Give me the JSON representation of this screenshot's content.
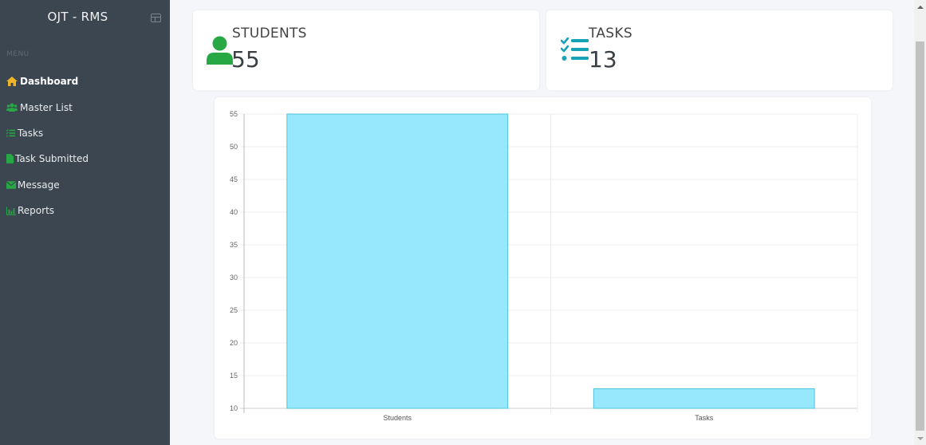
{
  "app": {
    "title": "OJT - RMS"
  },
  "sidebar": {
    "menu_header": "MENU",
    "items": [
      {
        "label": "Dashboard",
        "icon": "home-icon",
        "active": true
      },
      {
        "label": "Master List",
        "icon": "users-icon",
        "active": false
      },
      {
        "label": "Tasks",
        "icon": "list-check-icon",
        "active": false
      },
      {
        "label": "Task Submitted",
        "icon": "file-icon",
        "active": false
      },
      {
        "label": "Message",
        "icon": "envelope-icon",
        "active": false
      },
      {
        "label": "Reports",
        "icon": "chart-bar-icon",
        "active": false
      }
    ]
  },
  "stats": {
    "students": {
      "label": "STUDENTS",
      "value": "55",
      "icon": "user-icon",
      "color": "#28a745"
    },
    "tasks": {
      "label": "TASKS",
      "value": "13",
      "icon": "tasks-icon",
      "color": "#17a2b8"
    }
  },
  "colors": {
    "sidebar_bg": "#3b4650",
    "icon_green": "#28a745",
    "icon_home": "#f0b429",
    "bar_fill": "#97e8fc",
    "bar_border": "#4dc4dc"
  },
  "chart_data": {
    "type": "bar",
    "title": "",
    "xlabel": "",
    "ylabel": "",
    "categories": [
      "Students",
      "Tasks"
    ],
    "values": [
      55,
      13
    ],
    "ylim": [
      10,
      55
    ],
    "yticks": [
      10,
      15,
      20,
      25,
      30,
      35,
      40,
      45,
      50,
      55
    ],
    "grid": true,
    "legend": "none"
  }
}
